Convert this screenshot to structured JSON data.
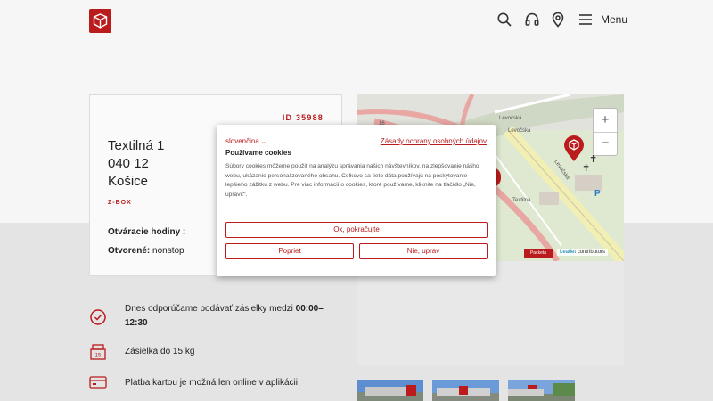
{
  "header": {
    "menu_label": "Menu",
    "icons": [
      "search-icon",
      "headset-icon",
      "location-icon",
      "menu-icon"
    ]
  },
  "branch": {
    "id_label": "ID 35988",
    "address_line1": "Textilná 1",
    "address_line2": "040 12",
    "address_line3": "Košice",
    "type": "Z-BOX",
    "hours_label": "Otváracie hodiny :",
    "open_label": "Otvorené:",
    "open_value": "nonstop"
  },
  "map": {
    "zoom_in": "+",
    "zoom_out": "−",
    "badge": "Packeta",
    "attribution_leaflet": "Leaflet",
    "attribution_contrib": "contributors",
    "street_labels": [
      "Levočská",
      "Levočská",
      "Levočská",
      "Textilná",
      "16"
    ]
  },
  "features": {
    "recommend_prefix": "Dnes odporúčame podávať zásielky medzi",
    "recommend_time": "00:00–",
    "recommend_time2": "12:30",
    "weight": "Zásielka do 15 kg",
    "weight_icon_text": "15",
    "card_payment": "Platba kartou je možná len online v aplikácii"
  },
  "cookie": {
    "language": "slovenčina",
    "policy_link": "Zásady ochrany osobných údajov",
    "title": "Používame cookies",
    "text": "Súbory cookies môžeme použiť na analýzu správania našich návštevníkov, na zlepšovanie nášho webu, ukázanie personalizovaného obsahu. Celkovo sa tieto dáta používajú na poskytovanie lepšieho zážitku z webu. Pre viac informácií o cookies, ktoré používame, kliknite na tlačidlo „Nie, upraviť“.",
    "accept": "Ok, pokračujte",
    "reject": "Popriet",
    "customize": "Nie, uprav"
  },
  "colors": {
    "brand": "#ba1b1d",
    "map_green": "#d7e5c8",
    "road_pink": "#e8a7a3",
    "road_yellow": "#f2efb5"
  }
}
